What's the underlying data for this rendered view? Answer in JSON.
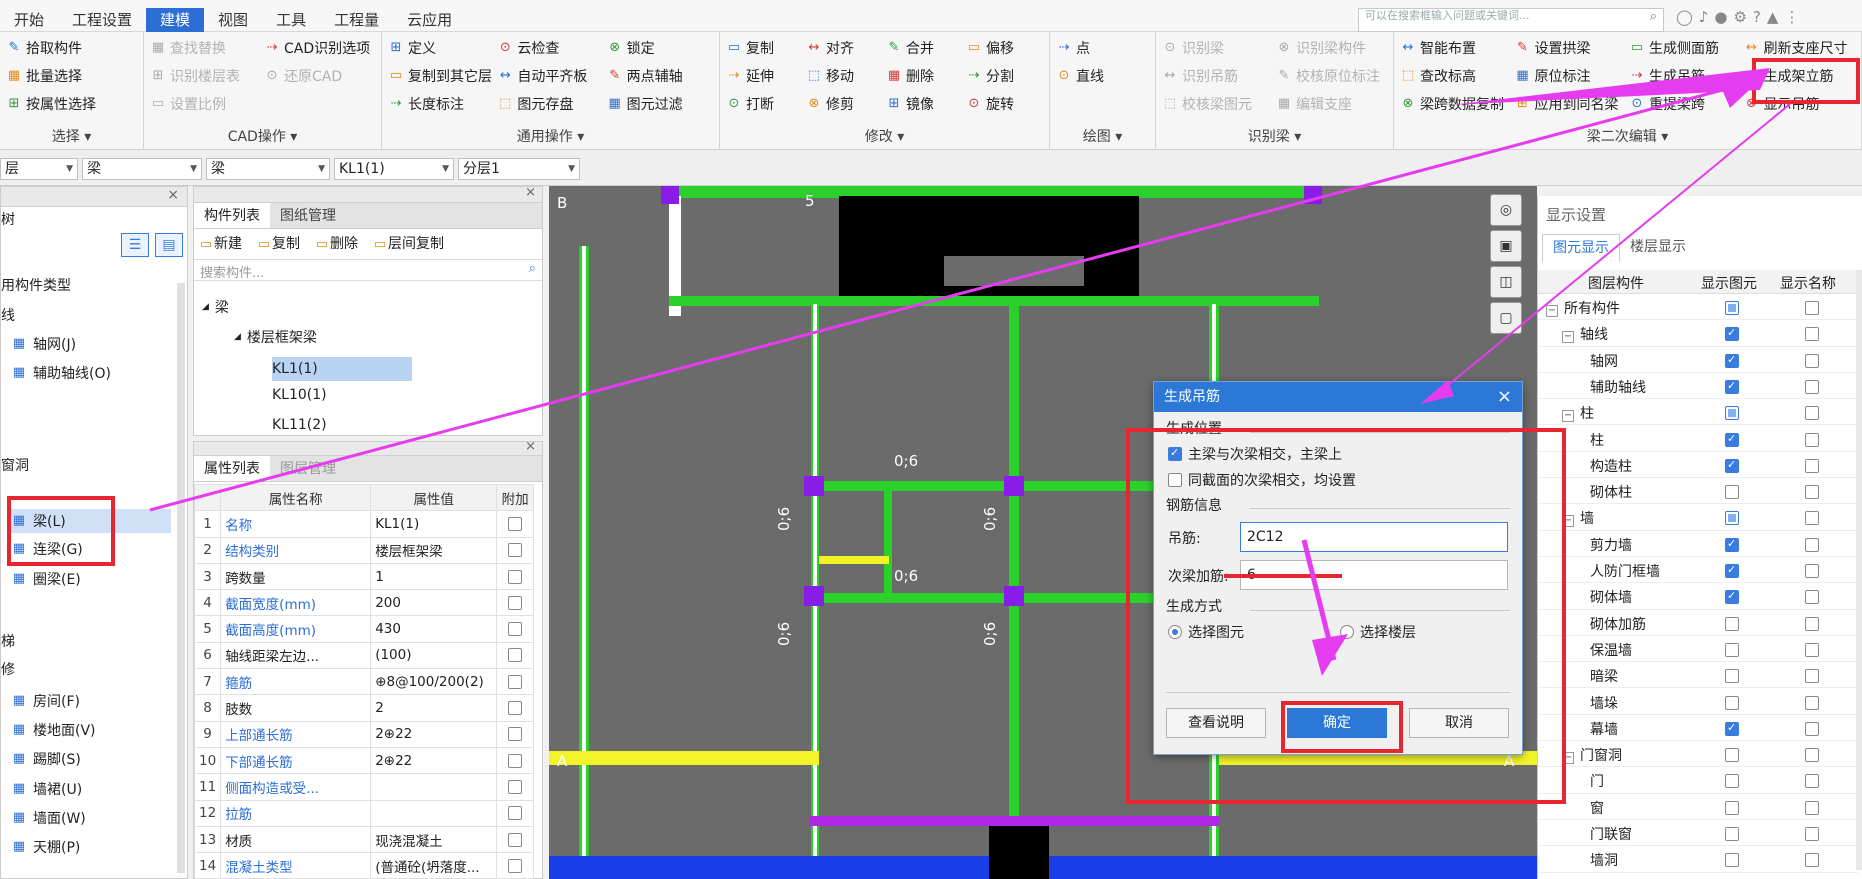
{
  "app": {
    "menu_tabs": [
      "开始",
      "工程设置",
      "建模",
      "视图",
      "工具",
      "工程量",
      "云应用"
    ],
    "active_tab": "建模",
    "search_placeholder": "可以在搜索框输入问题或关键词..."
  },
  "ribbon": {
    "groups": [
      {
        "label": "选择",
        "items": [
          "拾取构件",
          "批量选择",
          "按属性选择"
        ]
      },
      {
        "label": "CAD操作",
        "items": [
          "查找替换",
          "识别楼层表",
          "设置比例",
          "CAD识别选项",
          "还原CAD"
        ]
      },
      {
        "label": "通用操作",
        "items": [
          "定义",
          "复制到其它层",
          "长度标注",
          "云检查",
          "自动平齐板",
          "图元存盘",
          "锁定",
          "两点辅轴",
          "图元过滤"
        ]
      },
      {
        "label": "修改",
        "items": [
          "复制",
          "延伸",
          "打断",
          "对齐",
          "移动",
          "修剪",
          "合并",
          "删除",
          "镜像",
          "偏移",
          "分割",
          "旋转"
        ]
      },
      {
        "label": "绘图",
        "items": [
          "点",
          "直线"
        ]
      },
      {
        "label": "识别梁",
        "items": [
          "识别梁",
          "识别吊筋",
          "校核梁图元",
          "识别梁构件",
          "校核原位标注",
          "编辑支座"
        ]
      },
      {
        "label": "梁二次编辑",
        "items": [
          "智能布置",
          "查改标高",
          "梁跨数据复制",
          "设置拱梁",
          "原位标注",
          "应用到同名梁",
          "生成侧面筋",
          "生成吊筋",
          "重提梁跨",
          "刷新支座尺寸",
          "生成架立筋",
          "显示吊筋"
        ]
      }
    ]
  },
  "toolbar2": {
    "combos": [
      "层",
      "梁",
      "梁",
      "KL1(1)",
      "分层1"
    ]
  },
  "nav_tree": {
    "header": "树",
    "items": [
      "用构件类型",
      "线",
      "轴网(J)",
      "辅助轴线(O)",
      "窗洞",
      "梁(L)",
      "连梁(G)",
      "圈梁(E)",
      "梯",
      "修",
      "房间(F)",
      "楼地面(V)",
      "踢脚(S)",
      "墙裙(U)",
      "墙面(W)",
      "天棚(P)"
    ]
  },
  "component_list": {
    "tabs": [
      "构件列表",
      "图纸管理"
    ],
    "actions": [
      "新建",
      "复制",
      "删除",
      "层间复制"
    ],
    "search_placeholder": "搜索构件...",
    "tree": [
      "梁",
      "楼层框架梁",
      "KL1(1)",
      "KL10(1)",
      "KL11(2)"
    ]
  },
  "property_list": {
    "tabs": [
      "属性列表",
      "图层管理"
    ],
    "headers": [
      "",
      "属性名称",
      "属性值",
      "附加"
    ],
    "rows": [
      {
        "n": "1",
        "name": "名称",
        "value": "KL1(1)",
        "blue": true
      },
      {
        "n": "2",
        "name": "结构类别",
        "value": "楼层框架梁",
        "blue": true
      },
      {
        "n": "3",
        "name": "跨数量",
        "value": "1",
        "blue": false
      },
      {
        "n": "4",
        "name": "截面宽度(mm)",
        "value": "200",
        "blue": true
      },
      {
        "n": "5",
        "name": "截面高度(mm)",
        "value": "430",
        "blue": true
      },
      {
        "n": "6",
        "name": "轴线距梁左边...",
        "value": "(100)",
        "blue": false
      },
      {
        "n": "7",
        "name": "箍筋",
        "value": "⊕8@100/200(2)",
        "blue": true
      },
      {
        "n": "8",
        "name": "肢数",
        "value": "2",
        "blue": false
      },
      {
        "n": "9",
        "name": "上部通长筋",
        "value": "2⊕22",
        "blue": true
      },
      {
        "n": "10",
        "name": "下部通长筋",
        "value": "2⊕22",
        "blue": true
      },
      {
        "n": "11",
        "name": "侧面构造或受...",
        "value": "",
        "blue": true
      },
      {
        "n": "12",
        "name": "拉筋",
        "value": "",
        "blue": true
      },
      {
        "n": "13",
        "name": "材质",
        "value": "现浇混凝土",
        "blue": false
      },
      {
        "n": "14",
        "name": "混凝土类型",
        "value": "(普通砼(坍落度...",
        "blue": true
      }
    ]
  },
  "canvas": {
    "axis_labels": [
      "B",
      "5",
      "A",
      "A"
    ],
    "dim_labels": [
      "0;6",
      "0;6",
      "0;6",
      "0;6",
      "0;6",
      "0;6"
    ]
  },
  "dialog": {
    "title": "生成吊筋",
    "section_position": "生成位置",
    "opt1": "主梁与次梁相交，主梁上",
    "opt2": "同截面的次梁相交，均设置",
    "section_rebar": "钢筋信息",
    "label_hanger": "吊筋:",
    "value_hanger": "2C12",
    "label_secondary": "次梁加筋:",
    "value_secondary": "6",
    "section_method": "生成方式",
    "radio1": "选择图元",
    "radio2": "选择楼层",
    "btn_help": "查看说明",
    "btn_ok": "确定",
    "btn_cancel": "取消"
  },
  "display_settings": {
    "title": "显示设置",
    "tabs": [
      "图元显示",
      "楼层显示"
    ],
    "headers": [
      "图层构件",
      "显示图元",
      "显示名称"
    ],
    "rows": [
      {
        "name": "所有构件",
        "level": 0,
        "toggle": "−",
        "s1": "tri",
        "s2": "off"
      },
      {
        "name": "轴线",
        "level": 1,
        "toggle": "−",
        "s1": "on",
        "s2": "off"
      },
      {
        "name": "轴网",
        "level": 2,
        "toggle": "",
        "s1": "on",
        "s2": "off"
      },
      {
        "name": "辅助轴线",
        "level": 2,
        "toggle": "",
        "s1": "on",
        "s2": "off"
      },
      {
        "name": "柱",
        "level": 1,
        "toggle": "−",
        "s1": "tri",
        "s2": "off"
      },
      {
        "name": "柱",
        "level": 2,
        "toggle": "",
        "s1": "on",
        "s2": "off"
      },
      {
        "name": "构造柱",
        "level": 2,
        "toggle": "",
        "s1": "on",
        "s2": "off"
      },
      {
        "name": "砌体柱",
        "level": 2,
        "toggle": "",
        "s1": "off",
        "s2": "off"
      },
      {
        "name": "墙",
        "level": 1,
        "toggle": "−",
        "s1": "tri",
        "s2": "off"
      },
      {
        "name": "剪力墙",
        "level": 2,
        "toggle": "",
        "s1": "on",
        "s2": "off"
      },
      {
        "name": "人防门框墙",
        "level": 2,
        "toggle": "",
        "s1": "on",
        "s2": "off"
      },
      {
        "name": "砌体墙",
        "level": 2,
        "toggle": "",
        "s1": "on",
        "s2": "off"
      },
      {
        "name": "砌体加筋",
        "level": 2,
        "toggle": "",
        "s1": "off",
        "s2": "off"
      },
      {
        "name": "保温墙",
        "level": 2,
        "toggle": "",
        "s1": "off",
        "s2": "off"
      },
      {
        "name": "暗梁",
        "level": 2,
        "toggle": "",
        "s1": "off",
        "s2": "off"
      },
      {
        "name": "墙垛",
        "level": 2,
        "toggle": "",
        "s1": "off",
        "s2": "off"
      },
      {
        "name": "幕墙",
        "level": 2,
        "toggle": "",
        "s1": "on",
        "s2": "off"
      },
      {
        "name": "门窗洞",
        "level": 1,
        "toggle": "−",
        "s1": "off",
        "s2": "off"
      },
      {
        "name": "门",
        "level": 2,
        "toggle": "",
        "s1": "off",
        "s2": "off"
      },
      {
        "name": "窗",
        "level": 2,
        "toggle": "",
        "s1": "off",
        "s2": "off"
      },
      {
        "name": "门联窗",
        "level": 2,
        "toggle": "",
        "s1": "off",
        "s2": "off"
      },
      {
        "name": "墙洞",
        "level": 2,
        "toggle": "",
        "s1": "off",
        "s2": "off"
      }
    ]
  },
  "colors": {
    "accent": "#2b78d6",
    "highlight": "#e8262f",
    "annotation": "#e63cf0"
  }
}
